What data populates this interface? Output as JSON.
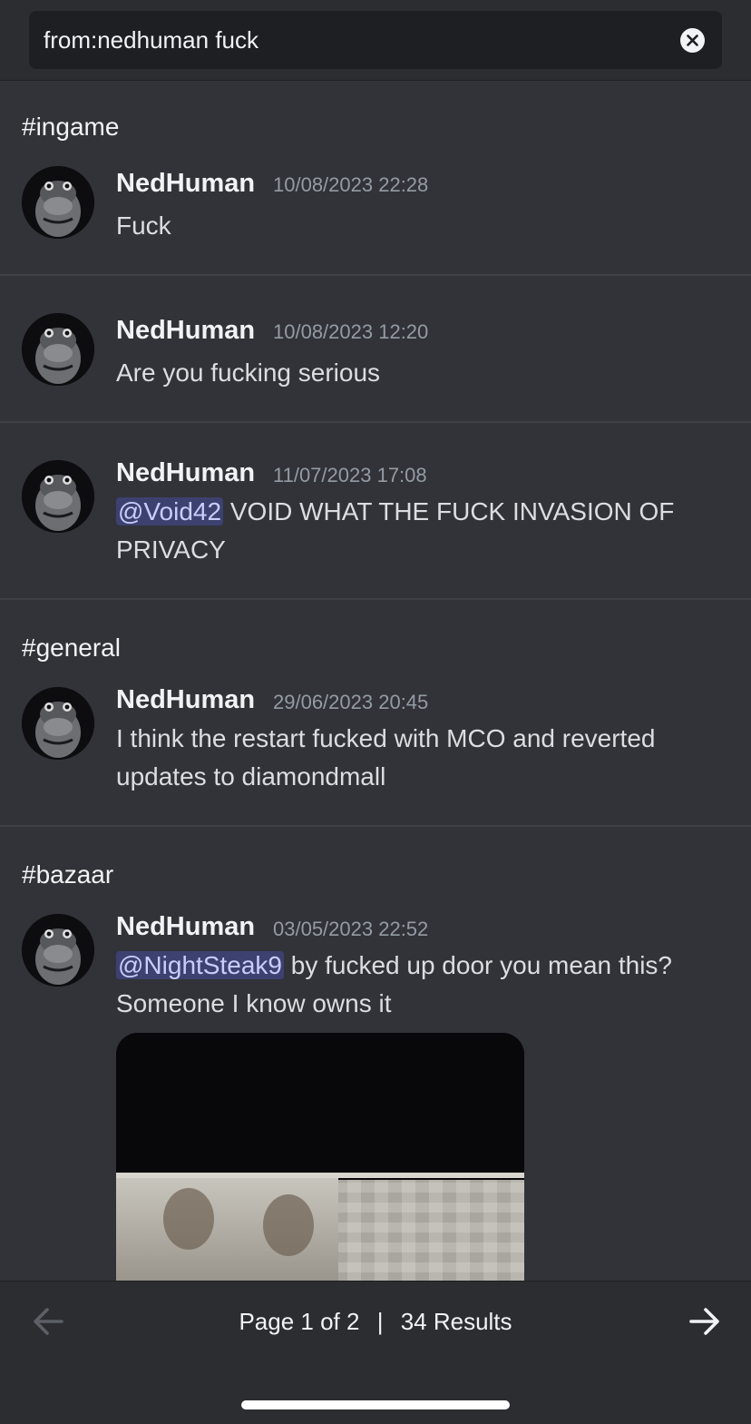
{
  "search": {
    "query": "from:nedhuman fuck"
  },
  "icons": {
    "clear": "close-circle-icon",
    "prev": "arrow-left-icon",
    "next": "arrow-right-icon"
  },
  "results": [
    {
      "channel": "#ingame",
      "author": "NedHuman",
      "timestamp": "10/08/2023 22:28",
      "text": "Fuck"
    },
    {
      "author": "NedHuman",
      "timestamp": "10/08/2023 12:20",
      "text": "Are you fucking serious"
    },
    {
      "author": "NedHuman",
      "timestamp": "11/07/2023 17:08",
      "mention": "@Void42",
      "text": " VOID WHAT THE FUCK INVASION OF PRIVACY"
    },
    {
      "channel": "#general",
      "author": "NedHuman",
      "timestamp": "29/06/2023 20:45",
      "text": "I think the restart fucked with MCO and reverted updates to diamondmall"
    },
    {
      "channel": "#bazaar",
      "author": "NedHuman",
      "timestamp": "03/05/2023 22:52",
      "mention": "@NightSteak9",
      "text": " by fucked up door you mean this? Someone I know owns it"
    }
  ],
  "pagination": {
    "page_text": "Page 1 of 2",
    "separator": "|",
    "count_text": "34 Results"
  },
  "colors": {
    "background": "#313338",
    "topbar": "#2b2d31",
    "mention_bg": "#4a4f8f",
    "mention_text": "#c9cdfb",
    "muted": "#949ba4"
  }
}
